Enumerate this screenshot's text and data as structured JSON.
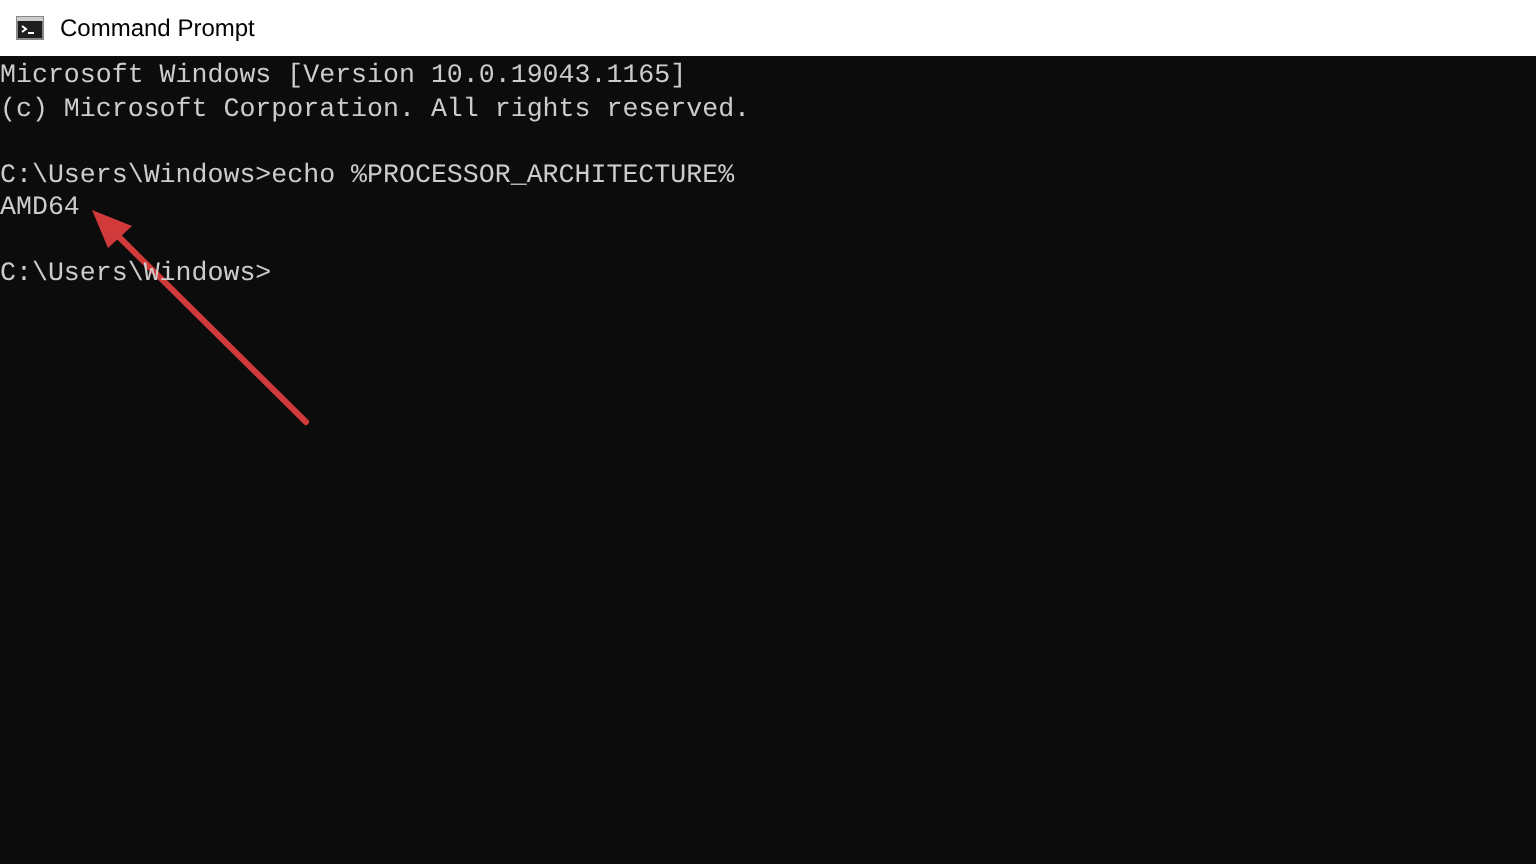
{
  "window": {
    "title": "Command Prompt"
  },
  "console": {
    "blocks": [
      [
        "Microsoft Windows [Version 10.0.19043.1165]",
        "(c) Microsoft Corporation. All rights reserved."
      ],
      [
        "C:\\Users\\Windows>echo %PROCESSOR_ARCHITECTURE%",
        "AMD64"
      ],
      [
        "C:\\Users\\Windows>"
      ]
    ]
  },
  "annotations": [
    {
      "kind": "arrow",
      "color": "#d03a3a"
    }
  ]
}
